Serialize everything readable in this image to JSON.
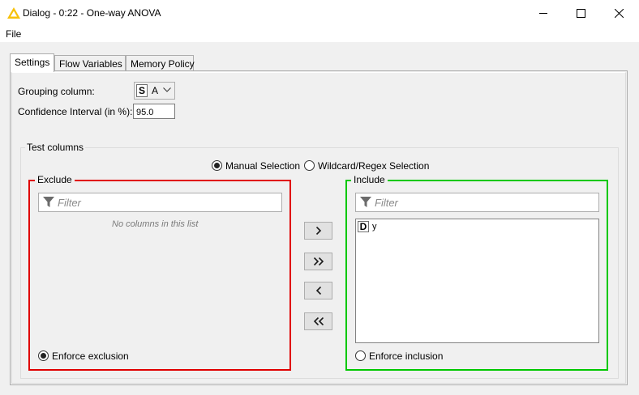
{
  "window": {
    "title": "Dialog - 0:22 - One-way ANOVA",
    "icon": "knime-triangle-icon",
    "minimize": "minimize-icon",
    "maximize": "maximize-icon",
    "close": "close-icon"
  },
  "menu": {
    "file": "File"
  },
  "tabs": [
    {
      "label": "Settings",
      "active": true
    },
    {
      "label": "Flow Variables",
      "active": false
    },
    {
      "label": "Memory Policy",
      "active": false
    }
  ],
  "settings": {
    "grouping_label": "Grouping column:",
    "grouping_type": "S",
    "grouping_value": "A",
    "ci_label": "Confidence Interval (in %):",
    "ci_value": "95.0"
  },
  "test_columns": {
    "title": "Test columns",
    "mode_manual": "Manual Selection",
    "mode_wildcard": "Wildcard/Regex Selection",
    "selected_mode": "manual",
    "exclude": {
      "title": "Exclude",
      "filter_placeholder": "Filter",
      "empty_text": "No columns in this list",
      "enforce_label": "Enforce exclusion",
      "enforce_checked": true,
      "border_color": "#e00000"
    },
    "include": {
      "title": "Include",
      "filter_placeholder": "Filter",
      "items": [
        {
          "type": "D",
          "name": "y"
        }
      ],
      "enforce_label": "Enforce inclusion",
      "enforce_checked": false,
      "border_color": "#00c800"
    },
    "buttons": {
      "add": "chevron-right-icon",
      "add_all": "double-chevron-right-icon",
      "remove": "chevron-left-icon",
      "remove_all": "double-chevron-left-icon"
    }
  }
}
